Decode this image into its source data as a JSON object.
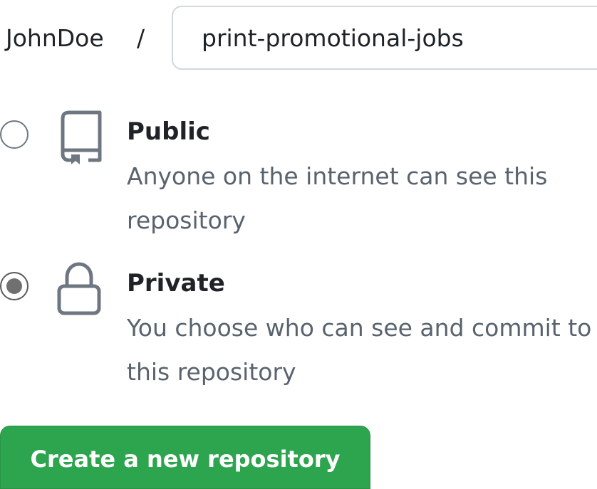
{
  "owner": {
    "name": "JohnDoe",
    "separator": "/"
  },
  "repository": {
    "name": "print-promotional-jobs"
  },
  "visibility": {
    "selected": "private",
    "options": [
      {
        "id": "public",
        "title": "Public",
        "description": "Anyone on the internet can see this repository",
        "icon": "repo-book-icon"
      },
      {
        "id": "private",
        "title": "Private",
        "description": "You choose who can see and commit to this repository",
        "icon": "lock-icon"
      }
    ]
  },
  "actions": {
    "create_label": "Create a new repository"
  },
  "colors": {
    "primary_button": "#2da44e",
    "muted_text": "#59636e",
    "border": "#d0d7de"
  }
}
